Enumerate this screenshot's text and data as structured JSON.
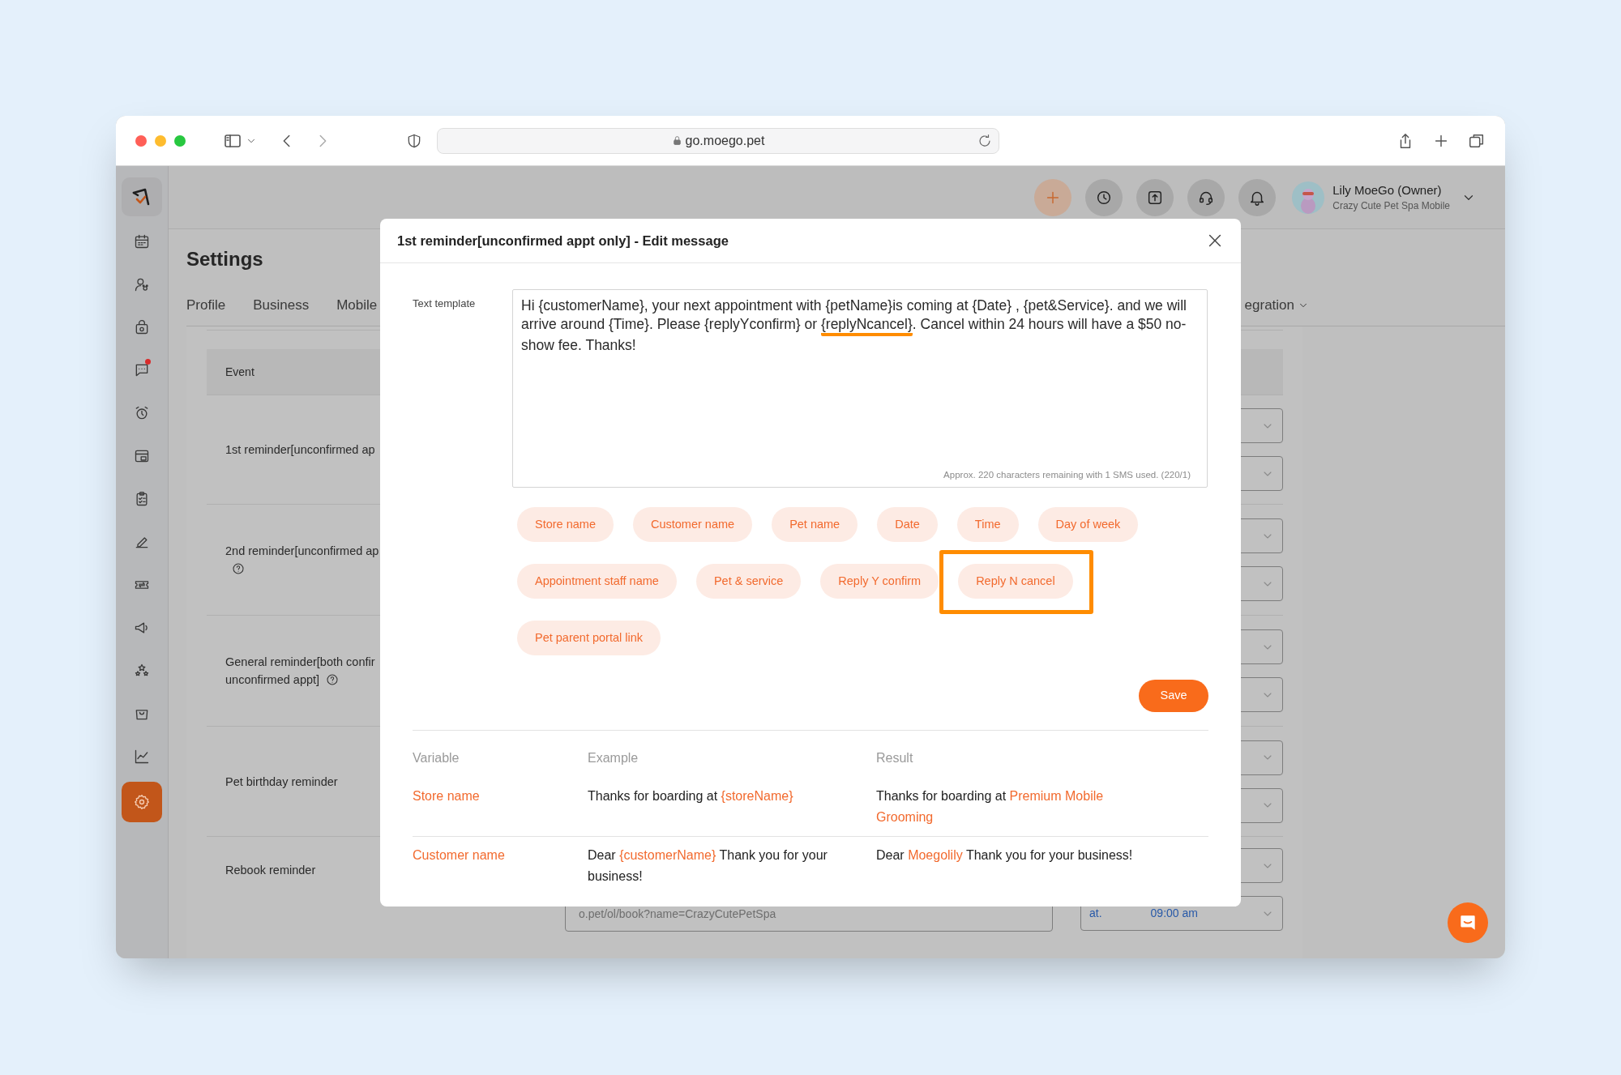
{
  "browser": {
    "url": "go.moego.pet"
  },
  "header": {
    "user_name": "Lily MoeGo (Owner)",
    "business": "Crazy Cute Pet Spa Mobile"
  },
  "sidebar": {
    "items": [
      {
        "kind": "calendar",
        "selected": false,
        "dot": false
      },
      {
        "kind": "client",
        "selected": false,
        "dot": false
      },
      {
        "kind": "bag",
        "selected": false,
        "dot": false
      },
      {
        "kind": "chat",
        "selected": false,
        "dot": true
      },
      {
        "kind": "alarm",
        "selected": false,
        "dot": false
      },
      {
        "kind": "store",
        "selected": false,
        "dot": false
      },
      {
        "kind": "clipboard",
        "selected": false,
        "dot": false
      },
      {
        "kind": "pen",
        "selected": false,
        "dot": false
      },
      {
        "kind": "ticket",
        "selected": false,
        "dot": false
      },
      {
        "kind": "megaphone",
        "selected": false,
        "dot": false
      },
      {
        "kind": "stars",
        "selected": false,
        "dot": false
      },
      {
        "kind": "basket",
        "selected": false,
        "dot": false
      },
      {
        "kind": "chart",
        "selected": false,
        "dot": false
      },
      {
        "kind": "settings",
        "selected": true,
        "dot": false
      }
    ]
  },
  "settings": {
    "title": "Settings",
    "tabs": [
      {
        "label": "Profile"
      },
      {
        "label": "Business"
      },
      {
        "label": "Mobile"
      }
    ],
    "right_tab": "egration",
    "event_table": {
      "header": "Event",
      "rows": [
        {
          "lines": [
            "1st reminder[unconfirmed ap"
          ],
          "help": false
        },
        {
          "lines": [
            "2nd reminder[unconfirmed ap"
          ],
          "help": true
        },
        {
          "lines": [
            "General reminder[both confir",
            "unconfirmed appt]"
          ],
          "help": true
        },
        {
          "lines": [
            "Pet birthday reminder"
          ],
          "help": false
        },
        {
          "lines": [
            "Rebook reminder"
          ],
          "help": false,
          "link_field": "o.pet/ol/book?name=CrazyCutePetSpa",
          "time_prefix": "at.",
          "time_value": "09:00 am"
        }
      ]
    }
  },
  "modal": {
    "title": "1st reminder[unconfirmed appt only] - Edit message",
    "template_label": "Text template",
    "template": [
      {
        "text": "Hi {customerName}, your next appointment with {petName}is coming at {Date} , {pet&Service}. and we will arrive around {Time}. Please {replyYconfirm} or ",
        "underlined": false
      },
      {
        "text": "{replyNcancel}",
        "underlined": true
      },
      {
        "text": ". Cancel within 24 hours will have a $50 no-show fee. Thanks!",
        "underlined": false
      }
    ],
    "counter": "Approx. 220 characters remaining with 1 SMS used. (220/1)",
    "chips": [
      {
        "label": "Store name",
        "highlighted": false
      },
      {
        "label": "Customer name",
        "highlighted": false
      },
      {
        "label": "Pet name",
        "highlighted": false
      },
      {
        "label": "Date",
        "highlighted": false
      },
      {
        "label": "Time",
        "highlighted": false
      },
      {
        "label": "Day of week",
        "highlighted": false
      },
      {
        "label": "Appointment staff name",
        "highlighted": false
      },
      {
        "label": "Pet & service",
        "highlighted": false
      },
      {
        "label": "Reply Y confirm",
        "highlighted": false
      },
      {
        "label": "Reply N cancel",
        "highlighted": true
      },
      {
        "label": "Pet parent portal link",
        "highlighted": false
      }
    ],
    "save": "Save",
    "variables": {
      "columns": [
        "Variable",
        "Example",
        "Result"
      ],
      "rows": [
        {
          "variable": "Store name",
          "example": [
            {
              "text": "Thanks for boarding at ",
              "highlight": false
            },
            {
              "text": "{storeName}",
              "highlight": true
            }
          ],
          "result": [
            {
              "text": "Thanks for boarding at ",
              "highlight": false
            },
            {
              "text": "Premium Mobile Grooming",
              "highlight": true
            }
          ]
        },
        {
          "variable": "Customer name",
          "example": [
            {
              "text": "Dear ",
              "highlight": false
            },
            {
              "text": "{customerName}",
              "highlight": true
            },
            {
              "text": " Thank you for your business!",
              "highlight": false
            }
          ],
          "result": [
            {
              "text": "Dear ",
              "highlight": false
            },
            {
              "text": "Moegolily",
              "highlight": true
            },
            {
              "text": " Thank you for your business!",
              "highlight": false
            }
          ]
        }
      ]
    }
  }
}
